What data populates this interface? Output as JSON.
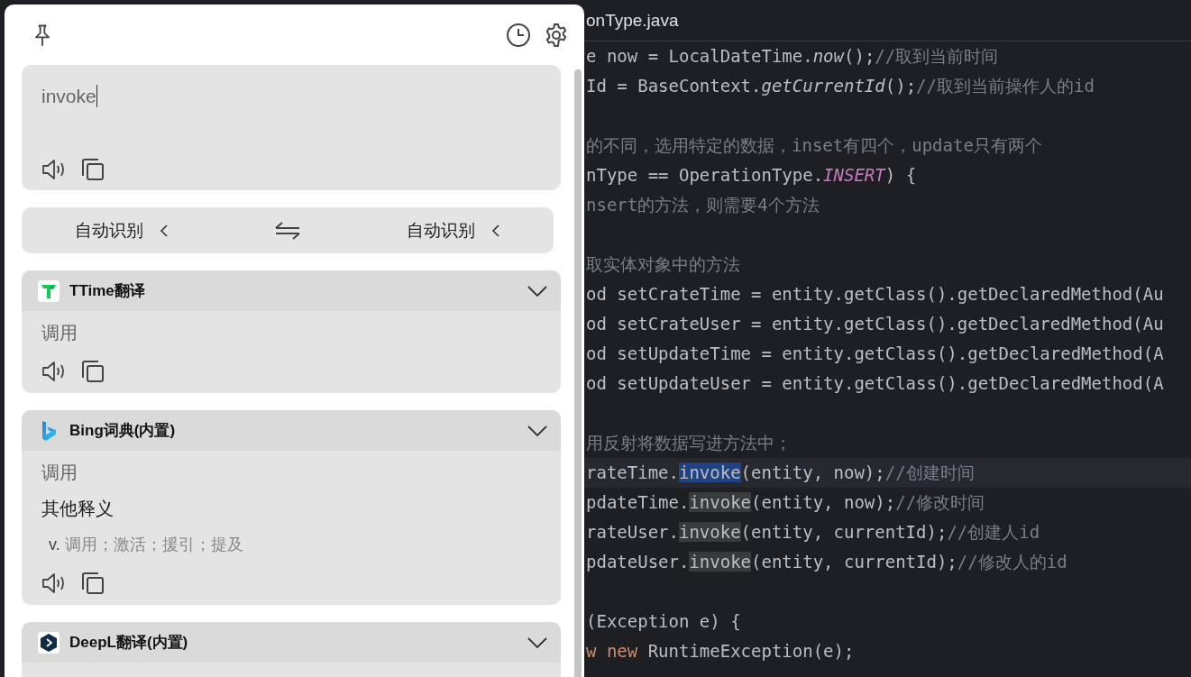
{
  "translator": {
    "source": {
      "value": "invoke"
    },
    "languages": {
      "from": "自动识别",
      "to": "自动识别"
    },
    "services": [
      {
        "name": "TTime翻译",
        "kind": "ttime",
        "results": [
          {
            "kind": "primary",
            "text": "调用"
          }
        ]
      },
      {
        "name": "Bing词典(内置)",
        "kind": "bing",
        "results": [
          {
            "kind": "primary",
            "text": "调用"
          },
          {
            "kind": "heading",
            "text": "其他释义"
          },
          {
            "kind": "definition",
            "pos": "v.",
            "text": "调用；激活；援引；提及"
          }
        ]
      },
      {
        "name": "DeepL翻译(内置)",
        "kind": "deepl"
      }
    ]
  },
  "editor": {
    "tab": "onType.java",
    "lines": [
      {
        "current": false,
        "kind": "code",
        "segments": [
          {
            "kind": "code",
            "text": "e now = LocalDateTime."
          },
          {
            "kind": "call",
            "text": "now"
          },
          {
            "kind": "code",
            "text": "();"
          },
          {
            "kind": "comment",
            "text": "//取到当前时间"
          }
        ]
      },
      {
        "current": false,
        "kind": "code",
        "segments": [
          {
            "kind": "code",
            "text": "Id = BaseContext."
          },
          {
            "kind": "call",
            "text": "getCurrentId"
          },
          {
            "kind": "code",
            "text": "();"
          },
          {
            "kind": "comment",
            "text": "//取到当前操作人的id"
          }
        ]
      },
      {
        "current": false,
        "kind": "blank"
      },
      {
        "current": false,
        "kind": "code",
        "segments": [
          {
            "kind": "comment",
            "text": "的不同，选用特定的数据，inset有四个，update只有两个"
          }
        ]
      },
      {
        "current": false,
        "kind": "code",
        "segments": [
          {
            "kind": "code",
            "text": "nType == OperationType."
          },
          {
            "kind": "constant",
            "text": "INSERT"
          },
          {
            "kind": "code",
            "text": ") {"
          }
        ]
      },
      {
        "current": false,
        "kind": "code",
        "segments": [
          {
            "kind": "comment",
            "text": "nsert的方法，则需要4个方法"
          }
        ]
      },
      {
        "current": false,
        "kind": "blank"
      },
      {
        "current": false,
        "kind": "code",
        "segments": [
          {
            "kind": "comment",
            "text": "取实体对象中的方法"
          }
        ]
      },
      {
        "current": false,
        "kind": "code",
        "segments": [
          {
            "kind": "code",
            "text": "od setCrateTime = entity.getClass().getDeclaredMethod(Au"
          }
        ]
      },
      {
        "current": false,
        "kind": "code",
        "segments": [
          {
            "kind": "code",
            "text": "od setCrateUser = entity.getClass().getDeclaredMethod(Au"
          }
        ]
      },
      {
        "current": false,
        "kind": "code",
        "segments": [
          {
            "kind": "code",
            "text": "od setUpdateTime = entity.getClass().getDeclaredMethod(A"
          }
        ]
      },
      {
        "current": false,
        "kind": "code",
        "segments": [
          {
            "kind": "code",
            "text": "od setUpdateUser = entity.getClass().getDeclaredMethod(A"
          }
        ]
      },
      {
        "current": false,
        "kind": "blank"
      },
      {
        "current": false,
        "kind": "code",
        "segments": [
          {
            "kind": "comment",
            "text": "用反射将数据写进方法中；"
          }
        ]
      },
      {
        "current": true,
        "kind": "code",
        "segments": [
          {
            "kind": "code",
            "text": "rateTime."
          },
          {
            "kind": "selection",
            "text": "invoke"
          },
          {
            "kind": "code",
            "text": "(entity, now);"
          },
          {
            "kind": "comment",
            "text": "//创建时间"
          }
        ]
      },
      {
        "current": false,
        "kind": "code",
        "segments": [
          {
            "kind": "code",
            "text": "pdateTime."
          },
          {
            "kind": "occurrence",
            "text": "invoke"
          },
          {
            "kind": "code",
            "text": "(entity, now);"
          },
          {
            "kind": "comment",
            "text": "//修改时间"
          }
        ]
      },
      {
        "current": false,
        "kind": "code",
        "segments": [
          {
            "kind": "code",
            "text": "rateUser."
          },
          {
            "kind": "occurrence",
            "text": "invoke"
          },
          {
            "kind": "code",
            "text": "(entity, currentId);"
          },
          {
            "kind": "comment",
            "text": "//创建人id"
          }
        ]
      },
      {
        "current": false,
        "kind": "code",
        "segments": [
          {
            "kind": "code",
            "text": "pdateUser."
          },
          {
            "kind": "occurrence",
            "text": "invoke"
          },
          {
            "kind": "code",
            "text": "(entity, currentId);"
          },
          {
            "kind": "comment",
            "text": "//修改人的id"
          }
        ]
      },
      {
        "current": false,
        "kind": "blank"
      },
      {
        "current": false,
        "kind": "code",
        "segments": [
          {
            "kind": "code",
            "text": "(Exception e) {"
          }
        ]
      },
      {
        "current": false,
        "kind": "code",
        "segments": [
          {
            "kind": "keyword",
            "text": "w new"
          },
          {
            "kind": "code",
            "text": " RuntimeException(e);"
          }
        ]
      }
    ]
  }
}
